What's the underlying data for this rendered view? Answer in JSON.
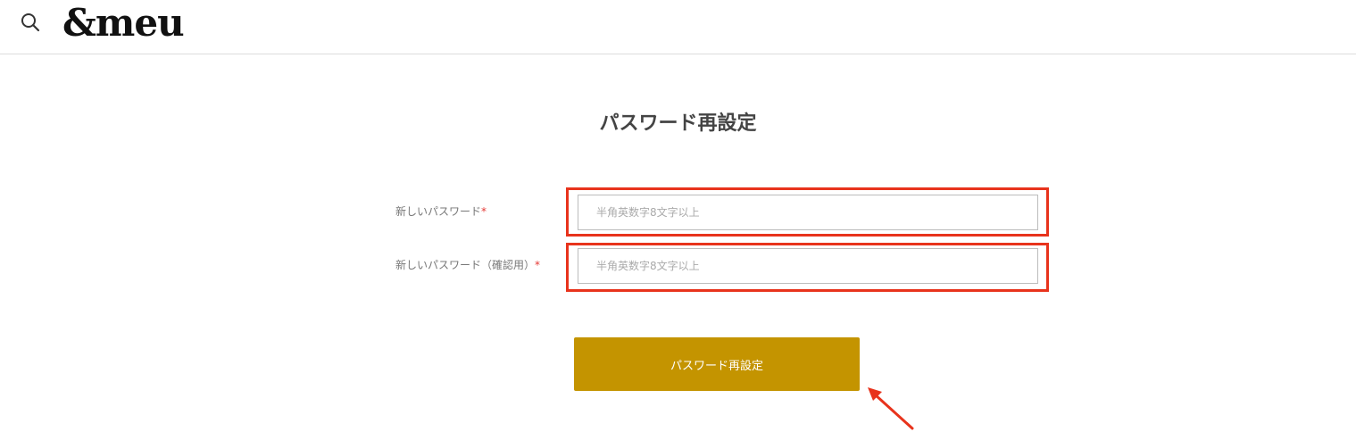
{
  "header": {
    "logo_text": "&meu",
    "search_icon": "search-icon"
  },
  "main": {
    "title": "パスワード再設定",
    "fields": [
      {
        "label": "新しいパスワード",
        "required_mark": "*",
        "placeholder": "半角英数字8文字以上",
        "value": ""
      },
      {
        "label": "新しいパスワード（確認用）",
        "required_mark": "*",
        "placeholder": "半角英数字8文字以上",
        "value": ""
      }
    ],
    "submit_label": "パスワード再設定"
  },
  "colors": {
    "accent_button": "#c49400",
    "highlight_annotation": "#e8331c",
    "required_mark": "#e53935"
  }
}
